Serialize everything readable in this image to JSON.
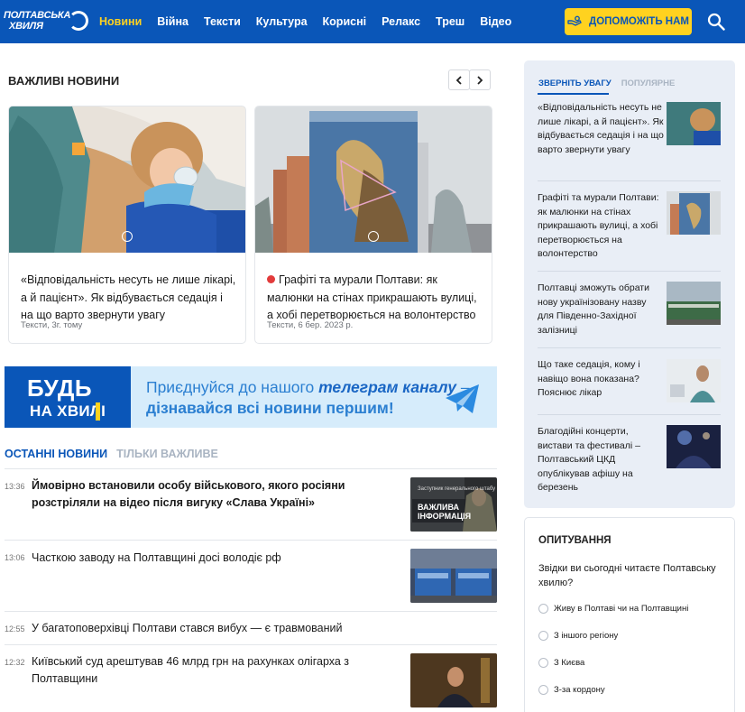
{
  "header": {
    "logo_line1": "ПОЛТАВСЬКА",
    "logo_line2": "ХВИЛЯ",
    "nav": [
      "Новини",
      "Війна",
      "Тексти",
      "Культура",
      "Корисні",
      "Релакс",
      "Треш",
      "Відео"
    ],
    "active_nav": "Новини",
    "donate_label": "ДОПОМОЖІТЬ НАМ"
  },
  "important": {
    "title": "ВАЖЛИВІ НОВИНИ",
    "cards": [
      {
        "title": "«Відповідальність несуть не лише лікарі, а й пацієнт». Як відбувається седація і на що варто звернути увагу",
        "meta": "Тексти, 3г. тому",
        "live": false
      },
      {
        "title": "Графіті та мурали Полтави: як малюнки на стінах прикрашають вулиці, а хобі перетворюється на волонтерство",
        "meta": "Тексти, 6 бер. 2023 р.",
        "live": true
      }
    ]
  },
  "banner": {
    "big_word": "БУДЬ",
    "small_word": "НА ХВИЛІ",
    "line1_prefix": "Приєднуйся до нашого ",
    "line1_emph": "телеграм каналу",
    "line1_suffix": " –",
    "line2": "дізнавайся всі новини першим!"
  },
  "latest": {
    "tab_latest": "ОСТАННІ НОВИНИ",
    "tab_important": "ТІЛЬКИ ВАЖЛИВЕ",
    "items": [
      {
        "time": "13:36",
        "title": "Ймовірно встановили особу військового, якого росіяни розстріляли на відео після вигуку «Слава Україні»",
        "bold": true,
        "thumb_caption": "ВАЖЛИВА ІНФОРМАЦІЯ",
        "thumb_header": "Заступник генерального штабу"
      },
      {
        "time": "13:06",
        "title": "Часткою заводу на Полтавщині досі володіє рф",
        "bold": false
      },
      {
        "time": "12:55",
        "title": "У багатоповерхівці Полтави стався вибух — є травмований",
        "bold": false
      },
      {
        "time": "12:32",
        "title": "Київський суд арештував 46 млрд грн на рахунках олігарха з Полтавщини",
        "bold": false
      }
    ]
  },
  "sidebar": {
    "tab_attention": "ЗВЕРНІТЬ УВАГУ",
    "tab_popular": "ПОПУЛЯРНЕ",
    "items": [
      "«Відповідальність несуть не лише лікарі, а й пацієнт». Як відбувається седація і на що варто звернути увагу",
      "Графіті та мурали Полтави: як малюнки на стінах прикрашають вулиці, а хобі перетворюється на волонтерство",
      "Полтавці зможуть обрати нову українізовану назву для Південно-Західної залізниці",
      "Що таке седація, кому і навіщо вона показана? Пояснює лікар",
      "Благодійні концерти, вистави та фестивалі – Полтавський ЦКД опублікував афішу на березень"
    ]
  },
  "poll": {
    "title": "ОПИТУВАННЯ",
    "question": "Звідки ви сьогодні читаєте Полтавську хвилю?",
    "options": [
      "Живу в Полтаві чи на Полтавщині",
      "З іншого регіону",
      "З Києва",
      "З-за кордону"
    ]
  },
  "colors": {
    "brand_blue": "#0a56b8",
    "accent_yellow": "#ffd21f",
    "sidebar_bg": "#e9eef6"
  }
}
